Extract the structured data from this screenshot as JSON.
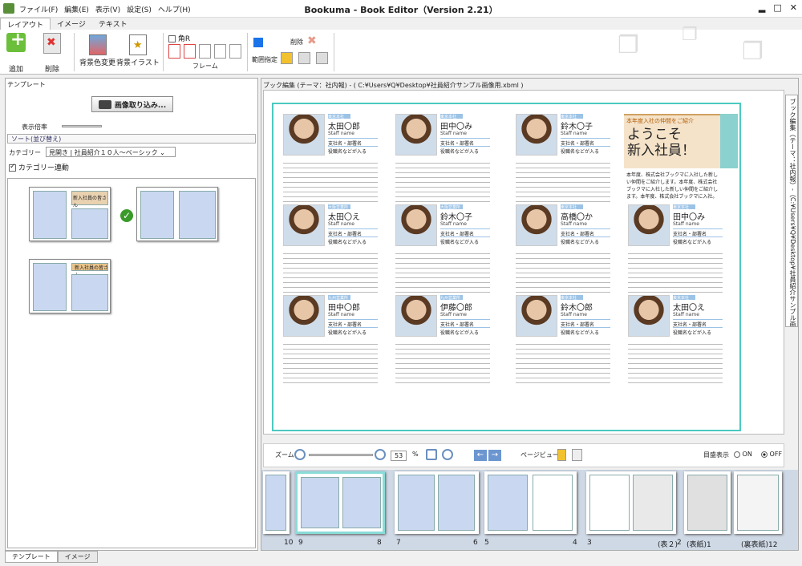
{
  "app": {
    "title": "Bookuma - Book Editor（Version 2.21）",
    "minimize": "▂",
    "maximize": "□",
    "close": "✕"
  },
  "menu": [
    "ファイル(F)",
    "編集(E)",
    "表示(V)",
    "設定(S)",
    "ヘルプ(H)"
  ],
  "ribbon_tabs": [
    "レイアウト",
    "イメージ",
    "テキスト"
  ],
  "ribbon": {
    "add": "追加",
    "delete": "削除",
    "bg_color": "背景色変更",
    "bg_illust": "背景イラスト",
    "kado": "角R",
    "frame": "フレーム",
    "range": "範囲指定",
    "delete2": "削除"
  },
  "left": {
    "header": "テンプレート",
    "import_btn": "画像取り込み...",
    "zoom_label": "表示倍率",
    "sort": "ソート(並び替え)",
    "category_label": "カテゴリー",
    "category_value": "見開き | 社員紹介１０人～ベーシック",
    "category_link": "カテゴリー連動",
    "thumb_text": "新入社員の皆さん",
    "thumb_text2": "新入社員の皆さん"
  },
  "bottom_tabs": [
    "テンプレート",
    "イメージ"
  ],
  "right": {
    "path": "ブック編集 (テーマ：社内報) - ( C:¥Users¥Q¥Desktop¥社員紹介サンプル画像用.xbml )",
    "vtab": "ブック編集（テーマ：社内報）-（C:¥Users¥Q¥Desktop¥社員紹介サンプル画像用.xbml）"
  },
  "cards": [
    {
      "tag": "東京本社",
      "name": "太田〇郎"
    },
    {
      "tag": "東京本社",
      "name": "田中〇み"
    },
    {
      "tag": "東京本社",
      "name": "鈴木〇子"
    },
    {
      "tag": "大阪営業所",
      "name": "太田〇え"
    },
    {
      "tag": "大阪営業所",
      "name": "鈴木〇子"
    },
    {
      "tag": "東京本社",
      "name": "高橋〇か"
    },
    {
      "tag": "東京本社",
      "name": "田中〇み"
    },
    {
      "tag": "九州営業所",
      "name": "田中〇郎"
    },
    {
      "tag": "九州営業所",
      "name": "伊藤〇郎"
    },
    {
      "tag": "東京本社",
      "name": "鈴木〇郎"
    },
    {
      "tag": "東京本社",
      "name": "太田〇え"
    }
  ],
  "card_common": {
    "sub": "Staff  name",
    "line1": "支社名・部署名",
    "line2": "役職名などが入る"
  },
  "welcome": {
    "small": "本年度入社の仲間をご紹介",
    "big1": "ようこそ",
    "big2": "新入社員！",
    "body": "本年度、株式会社ブックマに入社した新しい仲間をご紹介します。本年度、株式会社ブックマに入社した新しい仲間をご紹介します。本年度、株式会社ブックマに入社。"
  },
  "zoom": {
    "label": "ズーム",
    "value": "53",
    "unit": "%",
    "pageview": "ページビュー",
    "toc": "目盛表示",
    "on": "ON",
    "off": "OFF"
  },
  "pages": [
    {
      "left": "10",
      "right": ""
    },
    {
      "left": "9",
      "right": "8"
    },
    {
      "left": "7",
      "right": "6"
    },
    {
      "left": "5",
      "right": "4"
    },
    {
      "left": "3",
      "right": "(表２)"
    },
    {
      "left": "2",
      "right": "(表紙)1"
    },
    {
      "left": "",
      "right": "(裏表紙)12"
    }
  ]
}
